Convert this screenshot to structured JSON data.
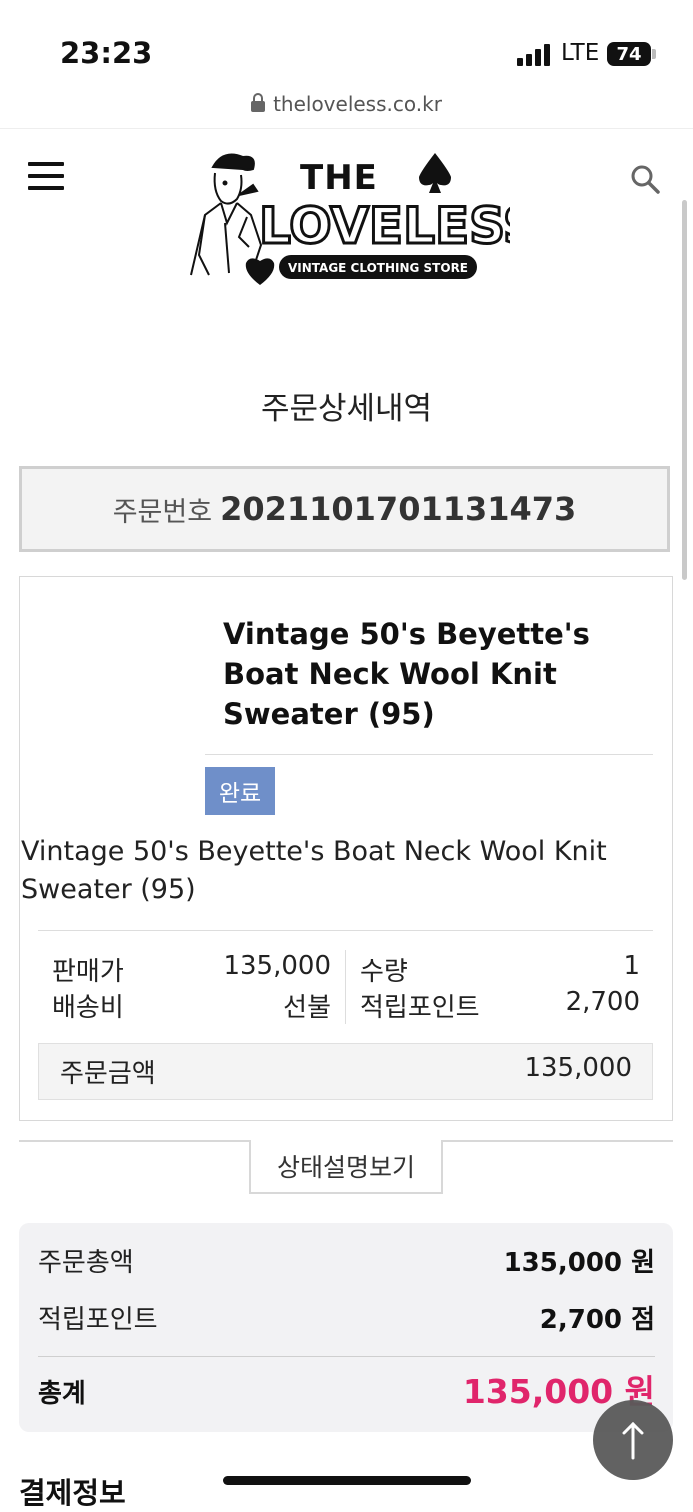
{
  "status_bar": {
    "time": "23:23",
    "carrier": "LTE",
    "battery": "74"
  },
  "browser": {
    "url": "theloveless.co.kr"
  },
  "header": {
    "logo_text_top": "THE",
    "logo_text_main": "LOVELESS",
    "logo_tagline": "VINTAGE CLOTHING STORE",
    "icons": {
      "menu": "hamburger-menu-icon",
      "search": "search-icon"
    }
  },
  "page": {
    "title": "주문상세내역"
  },
  "order": {
    "number_label": "주문번호",
    "number": "2021101701131473"
  },
  "product": {
    "title": "Vintage 50's Beyette's Boat Neck Wool Knit Sweater (95)",
    "status": "완료",
    "subtitle": "Vintage 50's Beyette's Boat Neck Wool Knit Sweater (95)",
    "price_label": "판매가",
    "price": "135,000",
    "shipping_label": "배송비",
    "shipping": "선불",
    "qty_label": "수량",
    "qty": "1",
    "points_label": "적립포인트",
    "points": "2,700",
    "order_amount_label": "주문금액",
    "order_amount": "135,000"
  },
  "status_desc_button": "상태설명보기",
  "summary": {
    "order_total_label": "주문총액",
    "order_total": "135,000 원",
    "points_label": "적립포인트",
    "points": "2,700 점",
    "total_label": "총계",
    "total": "135,000 원"
  },
  "payment_heading": "결제정보",
  "colors": {
    "status_badge": "#6f8fc9",
    "total_accent": "#e0256b"
  }
}
